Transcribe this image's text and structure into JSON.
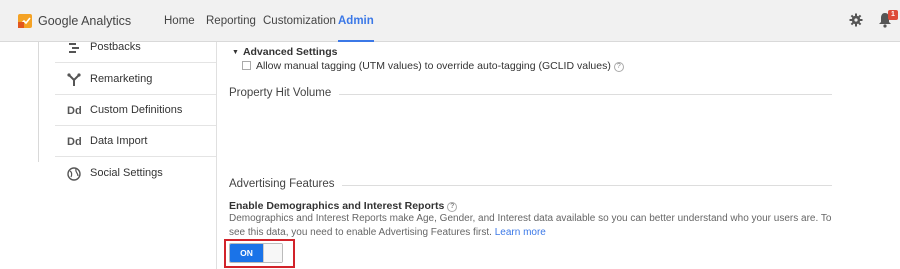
{
  "header": {
    "logo_text": "Google Analytics",
    "nav": [
      {
        "label": "Home"
      },
      {
        "label": "Reporting"
      },
      {
        "label": "Customization"
      },
      {
        "label": "Admin",
        "active": true
      }
    ],
    "settings_icon": "gear-icon",
    "notifications_icon": "bell-icon",
    "notification_count": "1"
  },
  "sidebar": {
    "items": [
      {
        "label": "Postbacks",
        "icon": "postbacks-icon"
      },
      {
        "label": "Remarketing",
        "icon": "remarketing-icon"
      },
      {
        "label": "Custom Definitions",
        "icon": "Dd"
      },
      {
        "label": "Data Import",
        "icon": "Dd"
      },
      {
        "label": "Social Settings",
        "icon": "globe-icon"
      }
    ]
  },
  "advanced": {
    "title": "Advanced Settings",
    "checkbox_label": "Allow manual tagging (UTM values) to override auto-tagging (GCLID values)",
    "checked": false
  },
  "sections": {
    "hit_volume": "Property Hit Volume",
    "advertising": "Advertising Features"
  },
  "demographics": {
    "title": "Enable Demographics and Interest Reports",
    "description": "Demographics and Interest Reports make Age, Gender, and Interest data available so you can better understand who your users are. To see this data, you need to enable Advertising Features first.",
    "learn_more": "Learn more",
    "toggle_label": "ON",
    "enabled": true
  },
  "colors": {
    "accent": "#3b78e7",
    "toggle_on": "#1a73e8",
    "highlight": "#d2232a"
  }
}
